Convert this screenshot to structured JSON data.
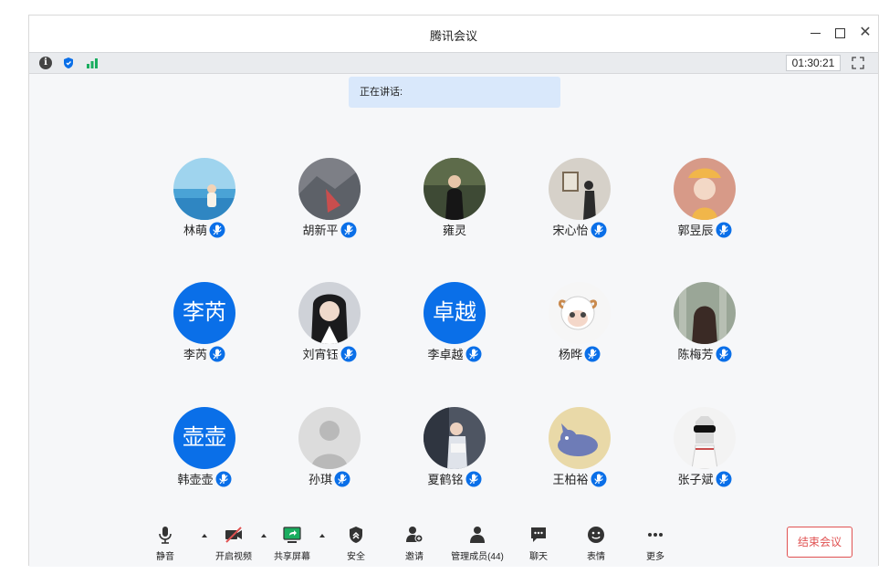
{
  "window": {
    "title": "腾讯会议"
  },
  "infobar": {
    "timer": "01:30:21",
    "signal_color": "#1aad5f",
    "shield_color": "#0a6fe8"
  },
  "speaking": {
    "label": "正在讲话:"
  },
  "participants": [
    {
      "name": "林萌",
      "avatar": "photo",
      "photo": "sea-girl"
    },
    {
      "name": "胡新平",
      "avatar": "photo",
      "photo": "rock"
    },
    {
      "name": "雍灵",
      "avatar": "photo",
      "photo": "dark-girl",
      "mic": false
    },
    {
      "name": "宋心怡",
      "avatar": "photo",
      "photo": "gallery"
    },
    {
      "name": "郭昱辰",
      "avatar": "photo",
      "photo": "hat-girl"
    },
    {
      "name": "李芮",
      "avatar": "text",
      "text": "李芮"
    },
    {
      "name": "刘宵钰",
      "avatar": "photo",
      "photo": "portrait"
    },
    {
      "name": "李卓越",
      "avatar": "text",
      "text": "卓越"
    },
    {
      "name": "杨晔",
      "avatar": "photo",
      "photo": "sheep"
    },
    {
      "name": "陈梅芳",
      "avatar": "photo",
      "photo": "forest-girl"
    },
    {
      "name": "韩壶壶",
      "avatar": "text",
      "text": "壶壶"
    },
    {
      "name": "孙琪",
      "avatar": "default"
    },
    {
      "name": "夏鹤铭",
      "avatar": "photo",
      "photo": "reading"
    },
    {
      "name": "王柏裕",
      "avatar": "photo",
      "photo": "cat"
    },
    {
      "name": "张子斌",
      "avatar": "photo",
      "photo": "dog"
    }
  ],
  "toolbar": {
    "mute": "静音",
    "video": "开启视频",
    "share": "共享屏幕",
    "security": "安全",
    "invite": "邀请",
    "members": "管理成员(44)",
    "chat": "聊天",
    "emoji": "表情",
    "more": "更多",
    "end": "结束会议"
  },
  "colors": {
    "accent": "#0a6fe8",
    "danger": "#e05252",
    "share_green": "#1aad5f"
  }
}
